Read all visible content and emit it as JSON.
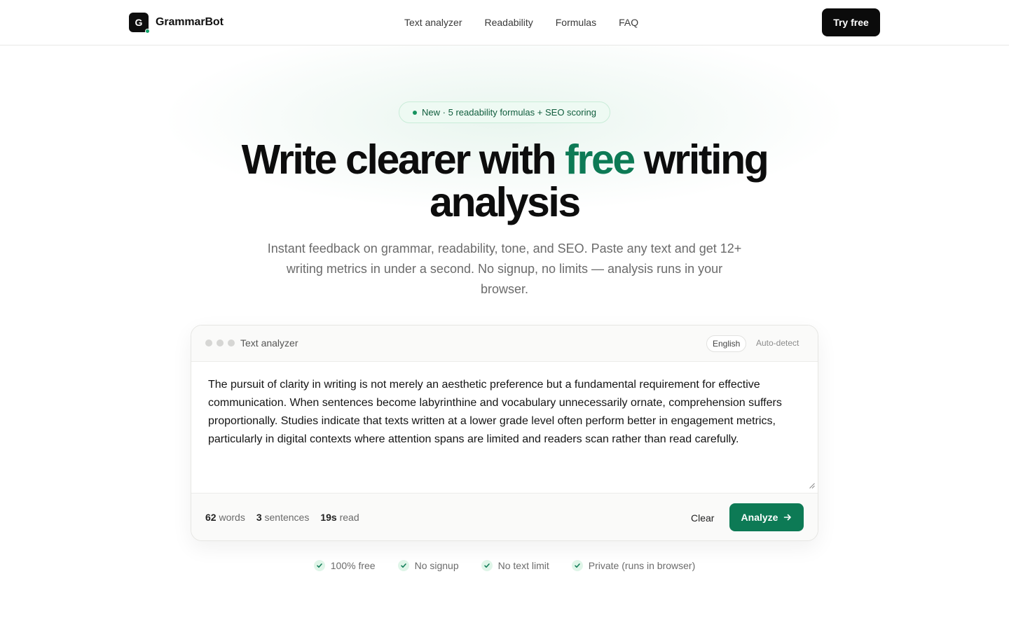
{
  "header": {
    "logo_letter": "G",
    "brand": "GrammarBot",
    "nav": [
      "Text analyzer",
      "Readability",
      "Formulas",
      "FAQ"
    ],
    "cta": "Try free"
  },
  "hero": {
    "badge": "New · 5 readability formulas + SEO scoring",
    "headline_before": "Write clearer with ",
    "headline_accent": "free",
    "headline_after": " writing analysis",
    "subtitle": "Instant feedback on grammar, readability, tone, and SEO. Paste any text and get 12+ writing metrics in under a second. No signup, no limits — analysis runs in your browser."
  },
  "analyzer": {
    "title": "Text analyzer",
    "language": "English",
    "auto_detect": "Auto-detect",
    "text": "The pursuit of clarity in writing is not merely an aesthetic preference but a fundamental requirement for effective communication. When sentences become labyrinthine and vocabulary unnecessarily ornate, comprehension suffers proportionally. Studies indicate that texts written at a lower grade level often perform better in engagement metrics, particularly in digital contexts where attention spans are limited and readers scan rather than read carefully.",
    "stats": {
      "words_value": "62",
      "words_label": "words",
      "sentences_value": "3",
      "sentences_label": "sentences",
      "read_value": "19s",
      "read_label": "read"
    },
    "clear_label": "Clear",
    "analyze_label": "Analyze"
  },
  "features": [
    "100% free",
    "No signup",
    "No text limit",
    "Private (runs in browser)"
  ],
  "colors": {
    "accent": "#0d7a55",
    "dark": "#0b0b0b",
    "badge_bg": "#eefaf3",
    "check_bg": "#dff5e8"
  }
}
